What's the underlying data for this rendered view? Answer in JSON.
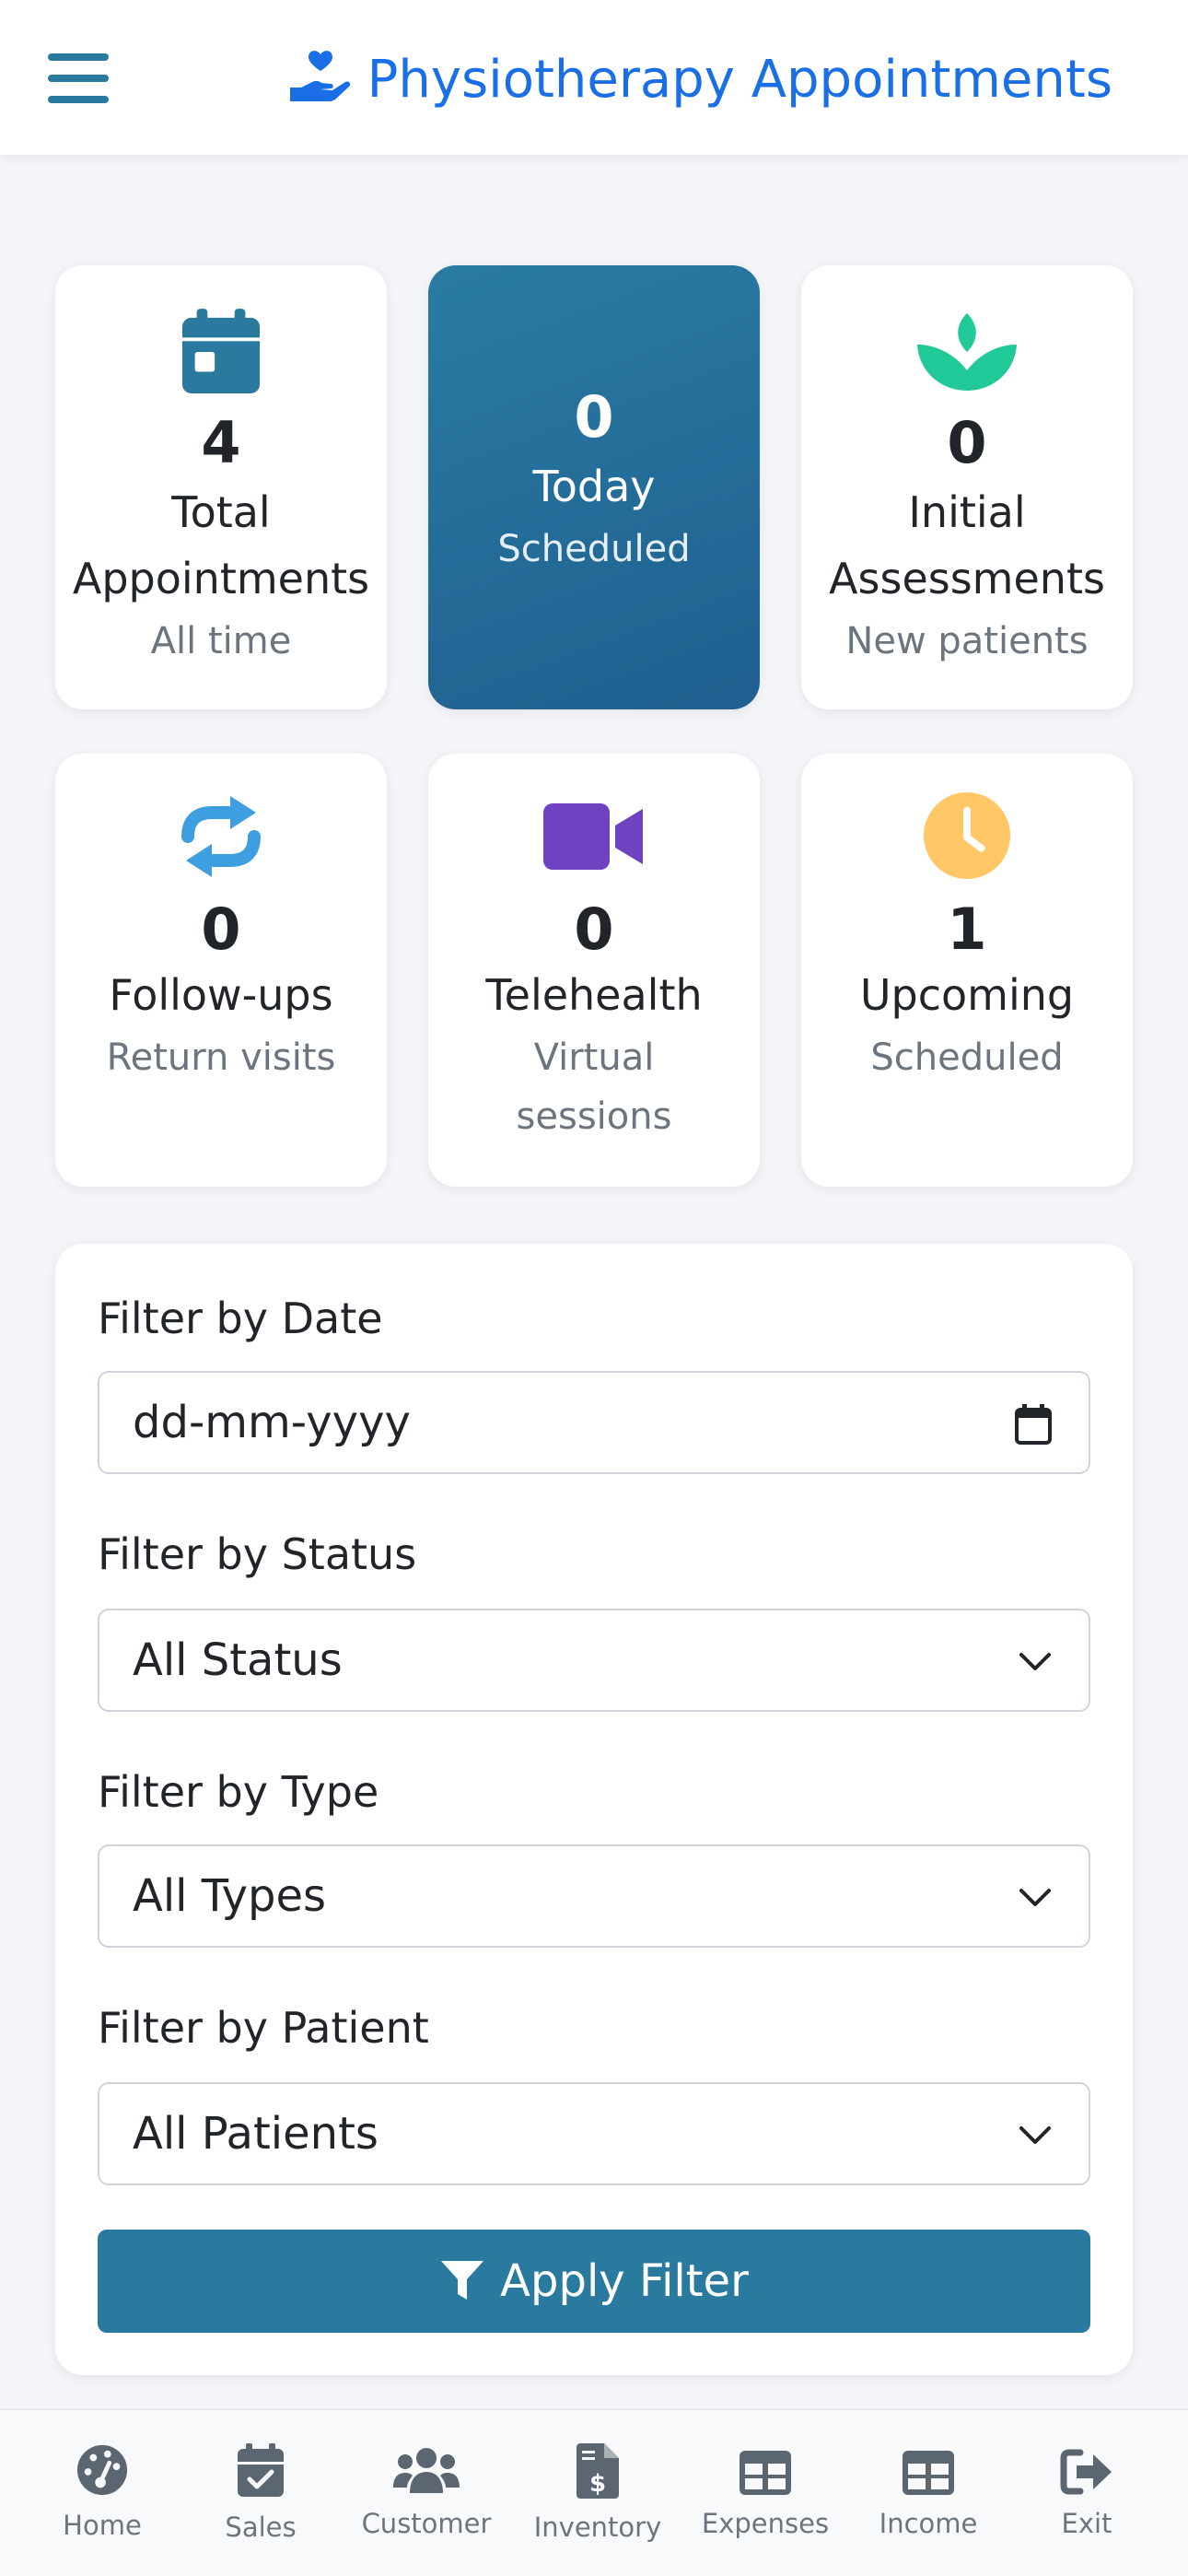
{
  "header": {
    "title": "Physiotherapy Appointments",
    "menu_icon": "hamburger-icon",
    "brand_icon": "hand-holding-heart-icon"
  },
  "stats": [
    {
      "number": "4",
      "label_line1": "Total",
      "label_line2": "Appointments",
      "sub": "All time",
      "icon": "calendar-icon",
      "color": "#2a7aa0"
    },
    {
      "number": "0",
      "label_line1": "Today",
      "sub": "Scheduled",
      "active": true
    },
    {
      "number": "0",
      "label_line1": "Initial",
      "label_line2": "Assessments",
      "sub": "New patients",
      "icon": "spa-icon",
      "color": "#20c997"
    },
    {
      "number": "0",
      "label_line1": "Follow-ups",
      "sub": "Return visits",
      "icon": "repeat-icon",
      "color": "#3d9ee0"
    },
    {
      "number": "0",
      "label_line1": "Telehealth",
      "sub_line1": "Virtual",
      "sub_line2": "sessions",
      "icon": "video-icon",
      "color": "#6f42c1"
    },
    {
      "number": "1",
      "label_line1": "Upcoming",
      "sub": "Scheduled",
      "icon": "clock-icon",
      "color": "#ffc766"
    }
  ],
  "filters": {
    "date_label": "Filter by Date",
    "date_placeholder": "dd-mm-yyyy",
    "status_label": "Filter by Status",
    "status_value": "All Status",
    "type_label": "Filter by Type",
    "type_value": "All Types",
    "patient_label": "Filter by Patient",
    "patient_value": "All Patients",
    "apply_label": "Apply Filter"
  },
  "nav": [
    {
      "label": "Home",
      "icon": "gauge-icon"
    },
    {
      "label": "Sales",
      "icon": "calendar-check-icon"
    },
    {
      "label": "Customer",
      "icon": "users-icon"
    },
    {
      "label": "Inventory",
      "icon": "file-invoice-dollar-icon"
    },
    {
      "label": "Expenses",
      "icon": "table-icon"
    },
    {
      "label": "Income",
      "icon": "table-icon"
    },
    {
      "label": "Exit",
      "icon": "sign-out-icon"
    }
  ]
}
